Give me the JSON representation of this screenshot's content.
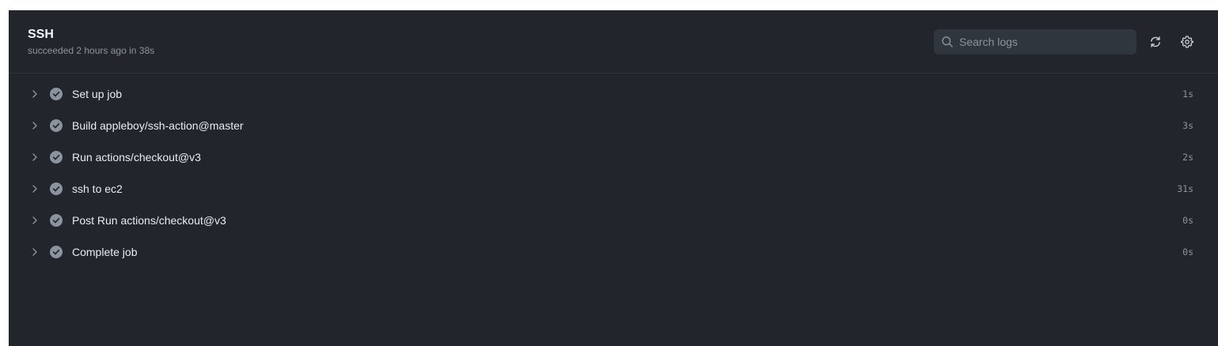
{
  "job": {
    "title": "SSH",
    "status": "succeeded 2 hours ago in 38s"
  },
  "search": {
    "placeholder": "Search logs",
    "value": ""
  },
  "toolbar": {
    "refresh_icon": "refresh-icon",
    "settings_icon": "gear-icon"
  },
  "colors": {
    "panel_bg": "#22262c",
    "success_check": "#8b949e",
    "text_primary": "#e6edf3",
    "text_muted": "#8b949e"
  },
  "steps": [
    {
      "name": "Set up job",
      "duration": "1s",
      "status": "success"
    },
    {
      "name": "Build appleboy/ssh-action@master",
      "duration": "3s",
      "status": "success"
    },
    {
      "name": "Run actions/checkout@v3",
      "duration": "2s",
      "status": "success"
    },
    {
      "name": "ssh to ec2",
      "duration": "31s",
      "status": "success"
    },
    {
      "name": "Post Run actions/checkout@v3",
      "duration": "0s",
      "status": "success"
    },
    {
      "name": "Complete job",
      "duration": "0s",
      "status": "success"
    }
  ]
}
